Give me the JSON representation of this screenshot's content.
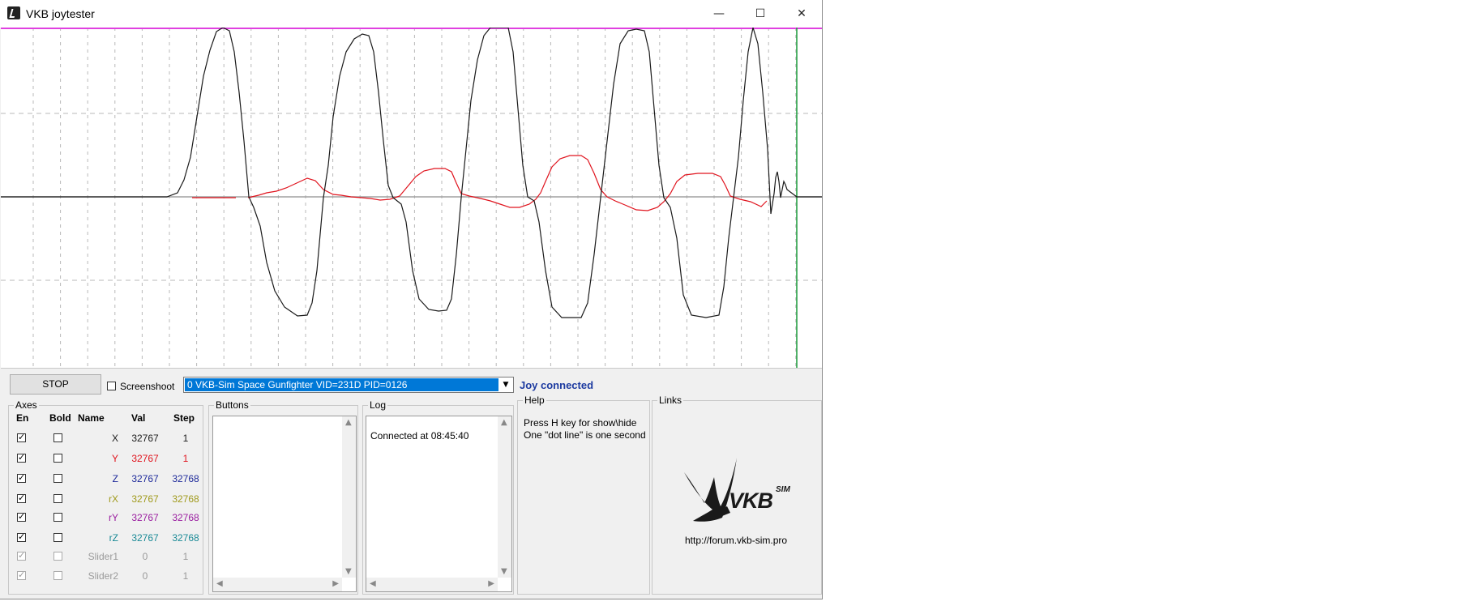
{
  "window": {
    "title": "VKB joytester"
  },
  "controls": {
    "stop_label": "STOP",
    "screenshot_label": "Screenshoot",
    "device_selected": "0  VKB-Sim Space Gunfighter  VID=231D PID=0126",
    "status": "Joy connected"
  },
  "axes": {
    "title": "Axes",
    "headers": {
      "en": "En",
      "bold": "Bold",
      "name": "Name",
      "val": "Val",
      "step": "Step"
    },
    "rows": [
      {
        "name": "X",
        "val": "32767",
        "step": "1",
        "color": "#1a1a1a",
        "enabled": true
      },
      {
        "name": "Y",
        "val": "32767",
        "step": "1",
        "color": "#e0141e",
        "enabled": true
      },
      {
        "name": "Z",
        "val": "32767",
        "step": "32768",
        "color": "#1e2a9a",
        "enabled": true
      },
      {
        "name": "rX",
        "val": "32767",
        "step": "32768",
        "color": "#a09a1c",
        "enabled": true
      },
      {
        "name": "rY",
        "val": "32767",
        "step": "32768",
        "color": "#9a1ea0",
        "enabled": true
      },
      {
        "name": "rZ",
        "val": "32767",
        "step": "32768",
        "color": "#1a8a96",
        "enabled": true
      },
      {
        "name": "Slider1",
        "val": "0",
        "step": "1",
        "color": "#9a9a9a",
        "enabled": false
      },
      {
        "name": "Slider2",
        "val": "0",
        "step": "1",
        "color": "#9a9a9a",
        "enabled": false
      }
    ]
  },
  "buttons_group": {
    "title": "Buttons"
  },
  "log": {
    "title": "Log",
    "lines": [
      "Connected at 08:45:40"
    ]
  },
  "help": {
    "title": "Help",
    "line1": "Press H key for show\\hide",
    "line2": "One \"dot line\" is one second"
  },
  "links": {
    "title": "Links",
    "logo_text": "VKB",
    "logo_sup": "SIM",
    "url": "http://forum.vkb-sim.pro"
  },
  "colors": {
    "top_line": "#e040e0",
    "cursor_line": "#1a9a3a",
    "grid": "#b8b8b8",
    "x_trace": "#1a1a1a",
    "y_trace": "#e0141e"
  }
}
